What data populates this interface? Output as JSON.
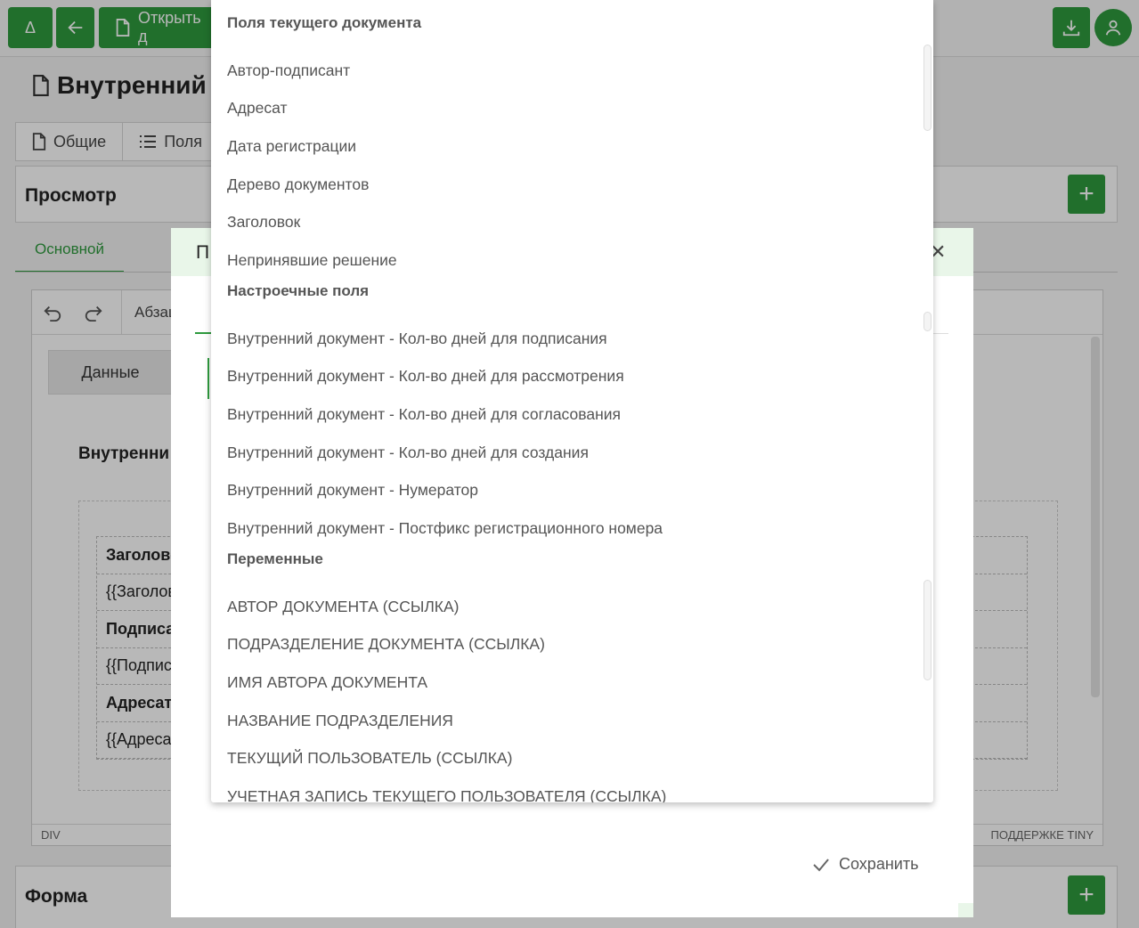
{
  "topbar": {
    "logo_label": "Δ",
    "open_label": "Открыть д"
  },
  "page": {
    "title": "Внутренний д"
  },
  "tabs": [
    {
      "label": "Общие"
    },
    {
      "label": "Поля"
    }
  ],
  "preview_panel": {
    "title": "Просмотр"
  },
  "form_panel": {
    "title": "Форма"
  },
  "subtab": {
    "label": "Основной"
  },
  "editor": {
    "paragraph_label": "Абзац",
    "data_button": "Данные",
    "doc_heading": "Внутренни",
    "rows": [
      "Заголово",
      "{{Заголов",
      "Подписа",
      "{{Подпис",
      "Адресат",
      "{{Адреса"
    ],
    "status_left": "DIV",
    "status_right": "ПОДДЕРЖКЕ TINY"
  },
  "modal": {
    "title": "П",
    "close_icon_glyph": "✕",
    "save_label": "Сохранить"
  },
  "dropdown": {
    "groups": [
      {
        "title": "Поля текущего документа",
        "items": [
          "Автор-подписант",
          "Адресат",
          "Дата регистрации",
          "Дерево документов",
          "Заголовок",
          "Непринявшие решение"
        ]
      },
      {
        "title": "Настроечные поля",
        "items": [
          "Внутренний документ - Кол-во дней для подписания",
          "Внутренний документ - Кол-во дней для рассмотрения",
          "Внутренний документ - Кол-во дней для согласования",
          "Внутренний документ - Кол-во дней для создания",
          "Внутренний документ - Нумератор",
          "Внутренний документ - Постфикс регистрационного номера"
        ]
      },
      {
        "title": "Переменные",
        "items": [
          "АВТОР ДОКУМЕНТА (ССЫЛКА)",
          "ПОДРАЗДЕЛЕНИЕ ДОКУМЕНТА (ССЫЛКА)",
          "ИМЯ АВТОРА ДОКУМЕНТА",
          "НАЗВАНИЕ ПОДРАЗДЕЛЕНИЯ",
          "ТЕКУЩИЙ ПОЛЬЗОВАТЕЛЬ (ССЫЛКА)",
          "УЧЕТНАЯ ЗАПИСЬ ТЕКУЩЕГО ПОЛЬЗОВАТЕЛЯ (ССЫЛКА)"
        ]
      }
    ]
  },
  "colors": {
    "accent": "#2e9a3e",
    "modal_header": "#e9f6e9",
    "overlay": "rgba(0,0,0,0.28)"
  }
}
